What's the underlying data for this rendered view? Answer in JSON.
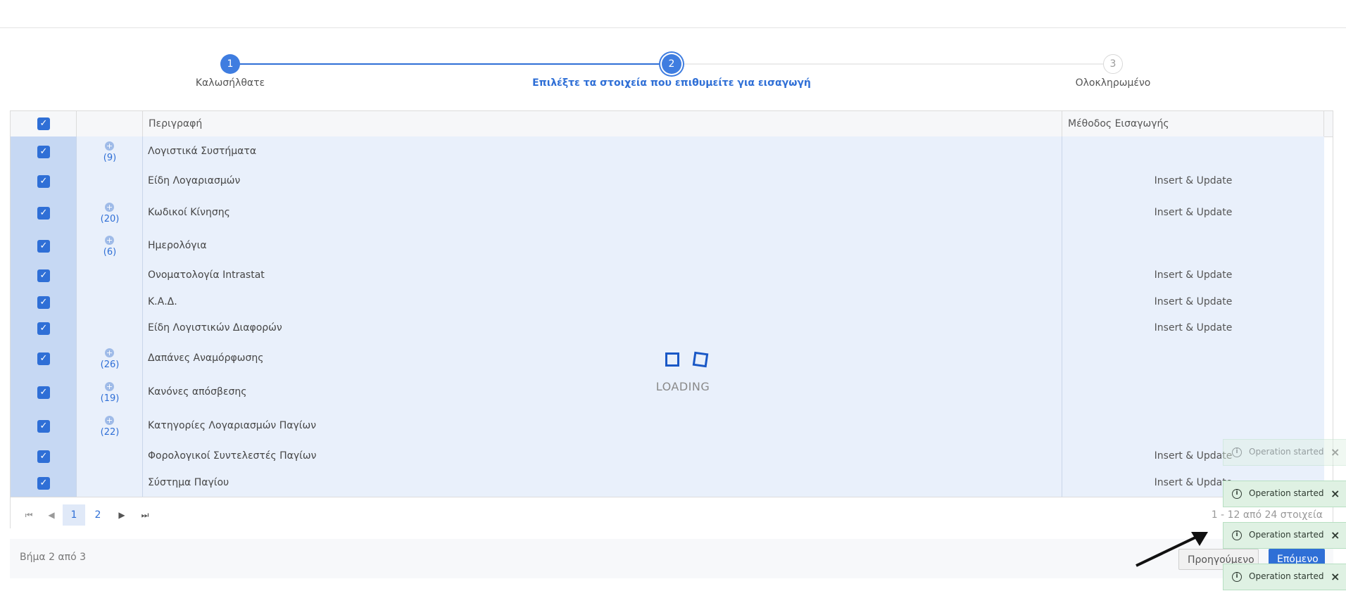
{
  "stepper": {
    "steps": [
      {
        "number": "1",
        "label": "Καλωσήλθατε"
      },
      {
        "number": "2",
        "label": "Επιλέξτε τα στοιχεία που επιθυμείτε για εισαγωγή"
      },
      {
        "number": "3",
        "label": "Ολοκληρωμένο"
      }
    ]
  },
  "grid": {
    "columns": {
      "description": "Περιγραφή",
      "method": "Μέθοδος Εισαγωγής"
    },
    "rows": [
      {
        "expand": "+",
        "count": "(9)",
        "description": "Λογιστικά Συστήματα",
        "method": ""
      },
      {
        "expand": "",
        "count": "",
        "description": "Είδη Λογαριασμών",
        "method": "Insert & Update"
      },
      {
        "expand": "+",
        "count": "(20)",
        "description": "Κωδικοί Κίνησης",
        "method": "Insert & Update"
      },
      {
        "expand": "+",
        "count": "(6)",
        "description": "Ημερολόγια",
        "method": ""
      },
      {
        "expand": "",
        "count": "",
        "description": "Ονοματολογία Intrastat",
        "method": "Insert & Update"
      },
      {
        "expand": "",
        "count": "",
        "description": "Κ.Α.Δ.",
        "method": "Insert & Update"
      },
      {
        "expand": "",
        "count": "",
        "description": "Είδη Λογιστικών Διαφορών",
        "method": "Insert & Update"
      },
      {
        "expand": "+",
        "count": "(26)",
        "description": "Δαπάνες Αναμόρφωσης",
        "method": ""
      },
      {
        "expand": "+",
        "count": "(19)",
        "description": "Κανόνες απόσβεσης",
        "method": ""
      },
      {
        "expand": "+",
        "count": "(22)",
        "description": "Κατηγορίες Λογαριασμών Παγίων",
        "method": ""
      },
      {
        "expand": "",
        "count": "",
        "description": "Φορολογικοί Συντελεστές Παγίων",
        "method": "Insert & Update"
      },
      {
        "expand": "",
        "count": "",
        "description": "Σύστημα Παγίου",
        "method": "Insert & Update"
      }
    ],
    "loading": "LOADING"
  },
  "pager": {
    "first_icon": "first-page-icon",
    "prev_icon": "prev-page-icon",
    "next_icon": "next-page-icon",
    "last_icon": "last-page-icon",
    "pages": [
      "1",
      "2"
    ],
    "info": "1 - 12 από 24 στοιχεία"
  },
  "footer": {
    "step_info": "Βήμα 2 από 3",
    "prev_label": "Προηγούμενο",
    "next_label": "Επόμενο"
  },
  "toasts": [
    {
      "text": "Operation started"
    },
    {
      "text": "Operation started"
    },
    {
      "text": "Operation started"
    },
    {
      "text": "Operation started"
    }
  ],
  "colors": {
    "accent": "#2f6fd6",
    "row_selected": "#e9f0fb",
    "toast_bg": "#dff1e3"
  }
}
